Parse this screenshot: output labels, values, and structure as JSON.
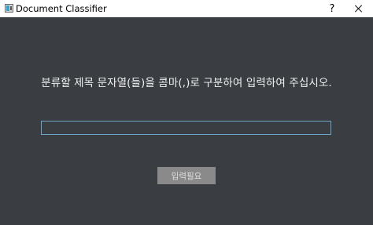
{
  "window": {
    "title": "Document Classifier",
    "help_label": "?"
  },
  "main": {
    "prompt": "분류할 제목 문자열(들)을 콤마(,)로 구분하여 입력하여 주십시오.",
    "input_value": "",
    "input_placeholder": "",
    "submit_label": "입력필요"
  },
  "colors": {
    "background": "#3a3e42",
    "input_border": "#6fa6c8",
    "button_disabled": "#8a8a8a"
  }
}
